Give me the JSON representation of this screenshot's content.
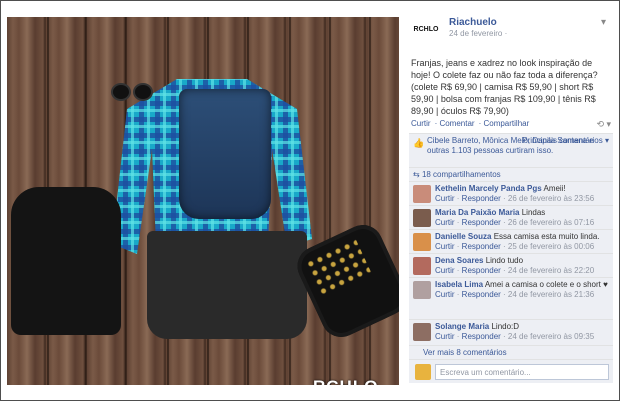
{
  "photo": {
    "watermark": "RCHLO"
  },
  "post": {
    "page_logo": "RCHLO",
    "page_name": "Riachuelo",
    "date": "24 de fevereiro ·",
    "text": "Franjas, jeans e xadrez no look inspiração de hoje! O colete faz ou não faz toda a diferença? (colete R$ 69,90 | camisa R$ 59,90 | short R$ 59,90 | bolsa com franjas R$ 109,90 | tênis R$ 89,90 | óculos R$ 79,90)",
    "actions": [
      "Curtir",
      "Comentar",
      "Compartilhar"
    ],
    "likes_text": "Cibele Barreto, Mônica Melo, Danila Santana e outras 1.103 pessoas curtiram isso.",
    "top_comments": "Principais comentários ▾",
    "shares": "18 compartilhamentos",
    "comments": [
      {
        "name": "Kethelin Marcely Panda Pgs",
        "text": "Ameii!",
        "reply": "Responder",
        "like": "Curtir",
        "date": "26 de fevereiro às 23:56",
        "avatar_color": "#c98c7a"
      },
      {
        "name": "Maria Da Paixão Maria",
        "text": "Lindas",
        "reply": "Responder",
        "like": "Curtir",
        "date": "26 de fevereiro às 07:16",
        "avatar_color": "#7a5c4d"
      },
      {
        "name": "Danielle Souza",
        "text": "Essa camisa esta muito linda.",
        "reply": "Responder",
        "like": "Curtir",
        "date": "25 de fevereiro às 00:06",
        "avatar_color": "#d9904a"
      },
      {
        "name": "Dena Soares",
        "text": "Lindo tudo",
        "reply": "Responder",
        "like": "Curtir",
        "date": "24 de fevereiro às 22:20",
        "avatar_color": "#b36a5e"
      },
      {
        "name": "Isabela Lima",
        "text": "Amei a camisa o colete e o short ♥",
        "reply": "Responder",
        "like": "Curtir",
        "date": "24 de fevereiro às 21:36",
        "avatar_color": "#b0a0a0"
      },
      {
        "name": "Solange Maria",
        "text": "Lindo:D",
        "reply": "Responder",
        "like": "Curtir",
        "date": "24 de fevereiro às 09:35",
        "avatar_color": "#8d6e63"
      }
    ],
    "more_comments": "Ver mais 8 comentários",
    "write_placeholder": "Escreva um comentário..."
  },
  "colors": {
    "link": "#3b5998",
    "meta": "#9197a3",
    "panel_bg": "#edeff4"
  }
}
